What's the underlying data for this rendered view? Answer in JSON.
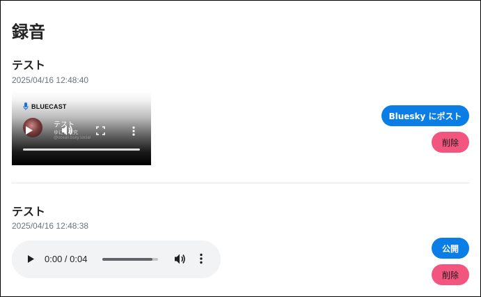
{
  "page": {
    "title": "録音"
  },
  "recordings": [
    {
      "title": "テスト",
      "date": "2025/04/16 12:48:40",
      "player": {
        "type": "video",
        "brand": "BLUECAST",
        "title": "テスト",
        "subtitle": "ゆにこ研究",
        "handle": "@ocean.bsky.social"
      },
      "actions": {
        "primary": "Bluesky にポスト",
        "delete": "削除"
      }
    },
    {
      "title": "テスト",
      "date": "2025/04/16 12:48:38",
      "player": {
        "type": "audio",
        "time": "0:00 / 0:04",
        "progress": 0.9
      },
      "actions": {
        "primary": "公開",
        "delete": "削除"
      }
    }
  ],
  "colors": {
    "primary_button": "#0b7de6",
    "delete_button": "#f2557e"
  }
}
